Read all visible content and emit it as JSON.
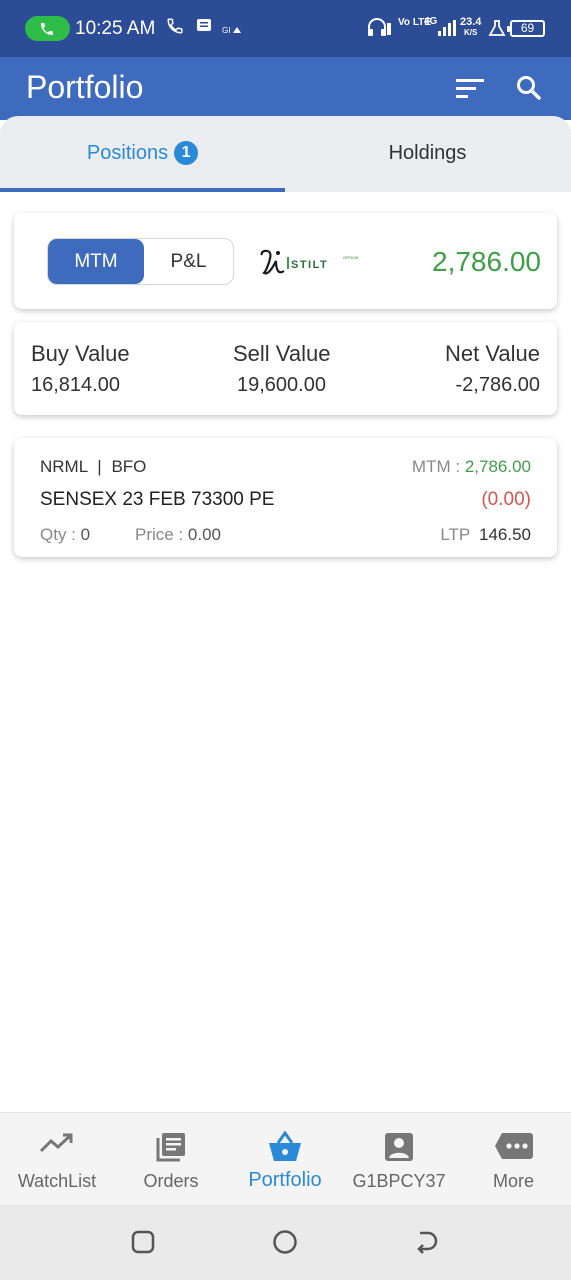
{
  "status_bar": {
    "time": "10:25 AM",
    "network_speed": "23.4",
    "network_unit": "K/S",
    "battery": "69",
    "network_type": "4G",
    "volte": "Vo LTE"
  },
  "app_bar": {
    "title": "Portfolio"
  },
  "tabs": [
    {
      "label": "Positions",
      "badge": "1",
      "active": true
    },
    {
      "label": "Holdings",
      "active": false
    }
  ],
  "summary": {
    "toggle": {
      "options": [
        "MTM",
        "P&L"
      ],
      "selected": "MTM"
    },
    "logo_text": "STILT",
    "value": "2,786.00"
  },
  "totals": {
    "buy_label": "Buy Value",
    "buy_value": "16,814.00",
    "sell_label": "Sell Value",
    "sell_value": "19,600.00",
    "net_label": "Net Value",
    "net_value": "-2,786.00"
  },
  "positions": [
    {
      "product": "NRML",
      "separator": "|",
      "exchange": "BFO",
      "mtm_label": "MTM :",
      "mtm_value": "2,786.00",
      "symbol": "SENSEX 23 FEB 73300 PE",
      "change": "(0.00)",
      "qty_label": "Qty :",
      "qty_value": "0",
      "price_label": "Price :",
      "price_value": "0.00",
      "ltp_label": "LTP",
      "ltp_value": "146.50"
    }
  ],
  "bottom_nav": [
    {
      "label": "WatchList",
      "icon": "trending-up-icon",
      "active": false
    },
    {
      "label": "Orders",
      "icon": "orders-icon",
      "active": false
    },
    {
      "label": "Portfolio",
      "icon": "basket-icon",
      "active": true
    },
    {
      "label": "G1BPCY37",
      "icon": "account-icon",
      "active": false
    },
    {
      "label": "More",
      "icon": "more-icon",
      "active": false
    }
  ],
  "colors": {
    "status_bar": "#2c4d96",
    "app_bar": "#3e6bbd",
    "accent": "#2a8ad8",
    "positive": "#3e9f47",
    "negative": "#d9534f"
  }
}
